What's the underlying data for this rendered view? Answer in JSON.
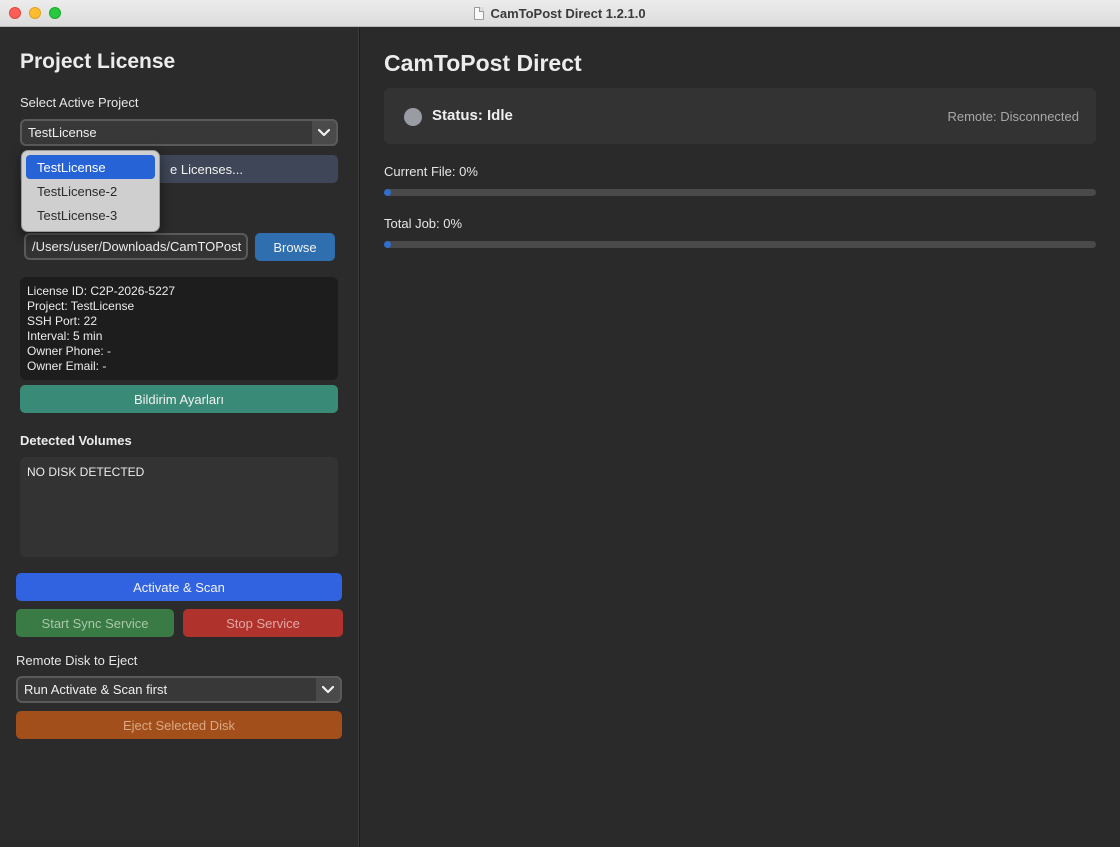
{
  "window": {
    "title": "CamToPost Direct 1.2.1.0"
  },
  "sidebar": {
    "heading": "Project License",
    "select_project_label": "Select Active Project",
    "project_selected": "TestLicense",
    "project_options": [
      "TestLicense",
      "TestLicense-2",
      "TestLicense-3"
    ],
    "manage_button": "Manage Licenses...",
    "manage_button_visible": "e Licenses...",
    "path_value": "/Users/user/Downloads/CamTOPost",
    "browse_button": "Browse",
    "info": {
      "license_id": "License ID: C2P-2026-5227",
      "project": "Project: TestLicense",
      "ssh_port": "SSH Port: 22",
      "interval": "Interval: 5 min",
      "owner_phone": "Owner Phone: -",
      "owner_email": "Owner Email: -"
    },
    "notification_button": "Bildirim Ayarları",
    "volumes_heading": "Detected Volumes",
    "volumes_text": "NO DISK DETECTED",
    "activate_button": "Activate & Scan",
    "start_button": "Start Sync Service",
    "stop_button": "Stop Service",
    "eject_label": "Remote Disk to Eject",
    "eject_selected": "Run Activate & Scan first",
    "eject_button": "Eject Selected Disk"
  },
  "main": {
    "heading": "CamToPost Direct",
    "status": "Status: Idle",
    "remote": "Remote: Disconnected",
    "current_file_label": "Current File: 0%",
    "current_file_progress": 0.01,
    "total_job_label": "Total Job: 0%",
    "total_job_progress": 0.01
  },
  "colors": {
    "accent_blue": "#3163e0",
    "teal": "#3a8a78",
    "green": "#3a7a45",
    "red": "#b0322c",
    "orange": "#a34f1c",
    "status_idle": "#9a9ca3"
  }
}
